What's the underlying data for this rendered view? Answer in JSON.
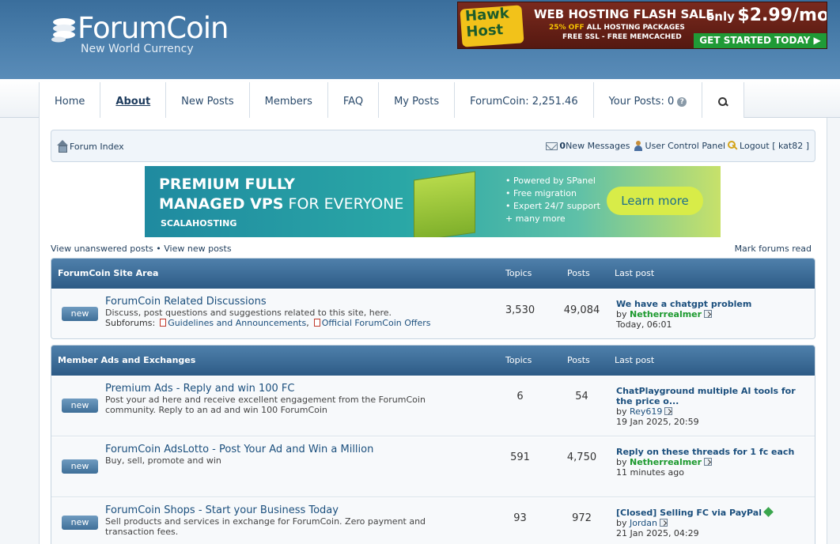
{
  "header": {
    "logo_title": "ForumCoin",
    "logo_subtitle": "New World Currency",
    "ad": {
      "brand": "Hawk Host",
      "line1": "WEB HOSTING FLASH SALE",
      "line2_highlight": "25% OFF",
      "line2_rest": "ALL HOSTING PACKAGES",
      "line3": "FREE SSL - FREE MEMCACHED",
      "price_prefix": "only",
      "price": "$2.99/mo",
      "cta": "GET STARTED TODAY ▶"
    }
  },
  "nav": {
    "items": [
      "Home",
      "About",
      "New Posts",
      "Members",
      "FAQ",
      "My Posts"
    ],
    "forumcoin": "ForumCoin: 2,251.46",
    "your_posts": "Your Posts: 0",
    "help": "?"
  },
  "crumb": {
    "forum_index": "Forum Index",
    "new_messages_count": "0",
    "new_messages_label": " New Messages",
    "ucp": "User Control Panel",
    "logout": "Logout [ kat82 ]"
  },
  "scala_ad": {
    "line1": "PREMIUM FULLY",
    "line2_bold": "MANAGED VPS",
    "line2_rest": " FOR EVERYONE",
    "brand": "SCALAHOSTING",
    "bullets": [
      "• Powered by SPanel",
      "• Free migration",
      "• Expert 24/7 support",
      "+ many more"
    ],
    "cta": "Learn more"
  },
  "links": {
    "unanswered": "View unanswered posts",
    "sep": " • ",
    "new_posts": "View new posts",
    "mark_read": "Mark forums read"
  },
  "categories": [
    {
      "title": "ForumCoin Site Area",
      "h_topics": "Topics",
      "h_posts": "Posts",
      "h_last": "Last post",
      "forums": [
        {
          "badge": "new",
          "title": "ForumCoin Related Discussions",
          "desc": "Discuss, post questions and suggestions related to this site, here.",
          "subforums_label": "Subforums:",
          "subforums": [
            "Guidelines and Announcements",
            "Official ForumCoin Offers"
          ],
          "topics": "3,530",
          "posts": "49,084",
          "last_title": "We have a chatgpt problem",
          "last_by": "by",
          "last_user": "Netherrealmer",
          "last_time": "Today, 06:01"
        }
      ]
    },
    {
      "title": "Member Ads and Exchanges",
      "h_topics": "Topics",
      "h_posts": "Posts",
      "h_last": "Last post",
      "forums": [
        {
          "badge": "new",
          "title": "Premium Ads - Reply and win 100 FC",
          "desc": "Post your ad here and receive excellent engagement from the ForumCoin community. Reply to an ad and win 100 ForumCoin",
          "topics": "6",
          "posts": "54",
          "last_title": "ChatPlayground multiple AI tools for the price o...",
          "last_by": "by",
          "last_user": "Rey619",
          "last_time": "19 Jan 2025, 20:59"
        },
        {
          "badge": "new",
          "title": "ForumCoin AdsLotto - Post Your Ad and Win a Million",
          "desc": "Buy, sell, promote and win",
          "topics": "591",
          "posts": "4,750",
          "last_title": "Reply on these threads for 1 fc each",
          "last_by": "by",
          "last_user": "Netherrealmer",
          "last_time": "11 minutes ago"
        },
        {
          "badge": "new",
          "title": "ForumCoin Shops - Start your Business Today",
          "desc": "Sell products and services in exchange for ForumCoin. Zero payment and transaction fees.",
          "topics": "93",
          "posts": "972",
          "last_title": "[Closed] Selling FC via PayPal",
          "last_by": "by",
          "last_user": "Jordan",
          "last_time": "21 Jan 2025, 04:29"
        }
      ]
    }
  ]
}
